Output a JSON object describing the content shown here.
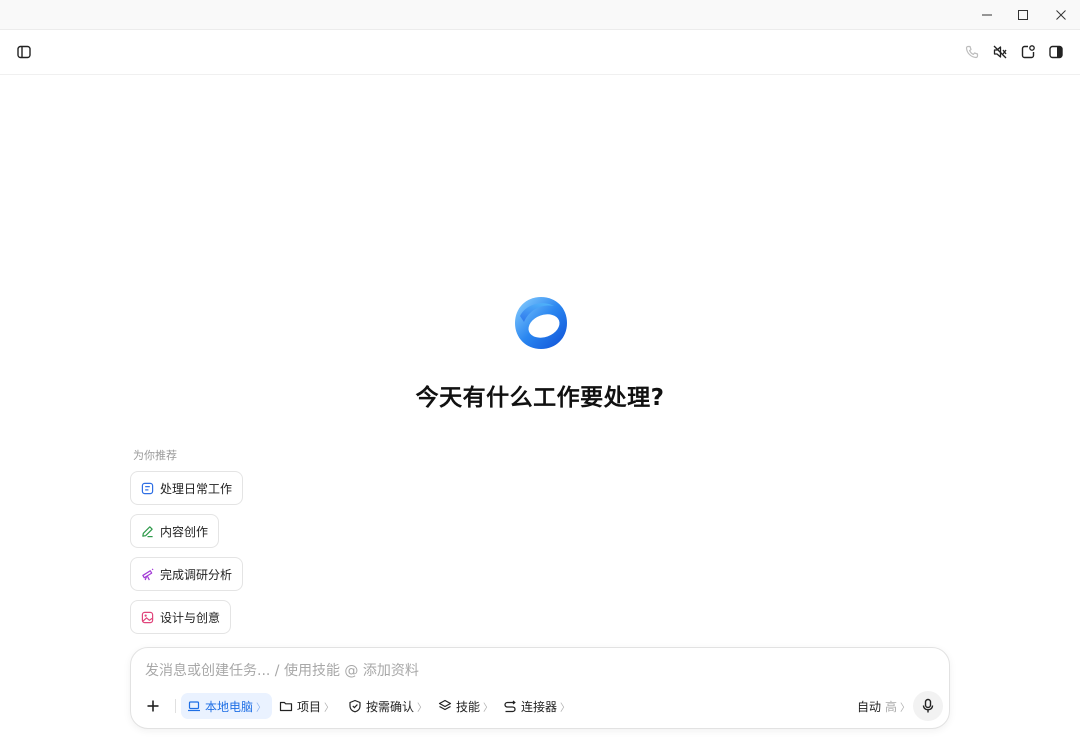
{
  "window": {
    "minimize_icon": "minimize-icon",
    "maximize_icon": "maximize-icon",
    "close_icon": "close-icon"
  },
  "toolbar": {
    "left_icon": "sidebar-toggle-icon",
    "right_icons": [
      "phone-icon",
      "mute-icon",
      "new-chat-icon",
      "right-panel-icon"
    ]
  },
  "main": {
    "heading": "今天有什么工作要处理?",
    "recommend_label": "为你推荐",
    "suggestions": [
      {
        "label": "处理日常工作",
        "icon": "task-icon",
        "color": "#2f6fe4"
      },
      {
        "label": "内容创作",
        "icon": "pen-icon",
        "color": "#2e9a4a"
      },
      {
        "label": "完成调研分析",
        "icon": "telescope-icon",
        "color": "#a23ad6"
      },
      {
        "label": "设计与创意",
        "icon": "image-icon",
        "color": "#e0457b"
      }
    ]
  },
  "composer": {
    "placeholder": "发消息或创建任务... / 使用技能 @ 添加资料",
    "add_icon": "plus-icon",
    "options": [
      {
        "label": "本地电脑",
        "icon": "laptop-icon",
        "chevron": "〉"
      },
      {
        "label": "项目",
        "icon": "folder-icon",
        "chevron": "〉"
      },
      {
        "label": "按需确认",
        "icon": "shield-check-icon",
        "chevron": "〉"
      },
      {
        "label": "技能",
        "icon": "layers-icon",
        "chevron": "〉"
      },
      {
        "label": "连接器",
        "icon": "connector-icon",
        "chevron": "〉"
      }
    ],
    "mode_label": "自动",
    "mode_level": "高",
    "mode_chevron": "〉",
    "mic_icon": "microphone-icon"
  },
  "colors": {
    "accent": "#1f6fe5",
    "accent_bg": "#eaf2ff"
  }
}
